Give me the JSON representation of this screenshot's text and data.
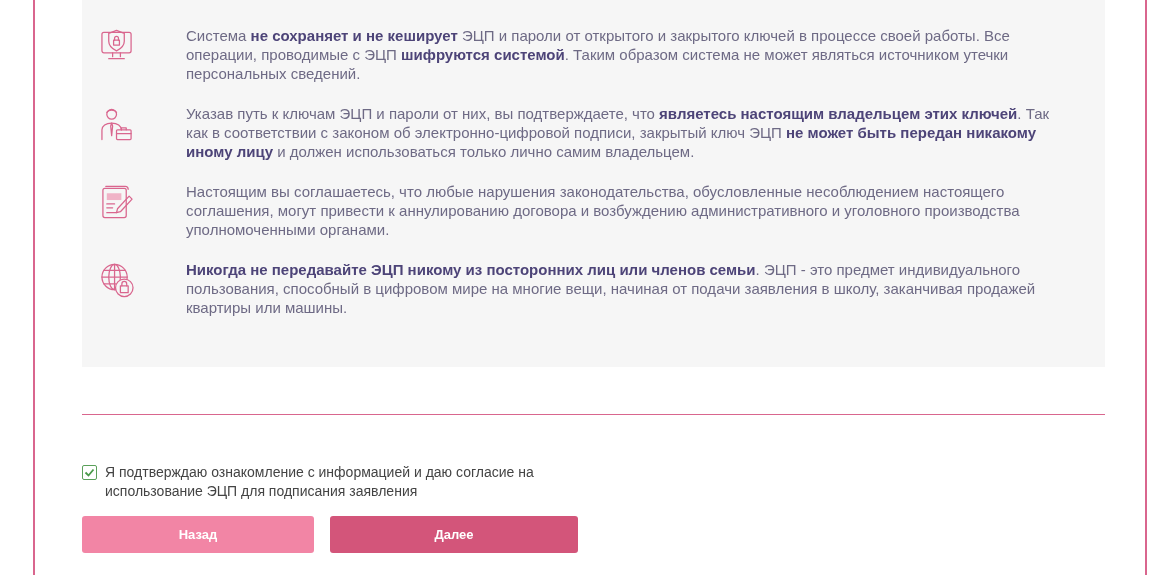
{
  "notices": [
    {
      "kind": "monitor",
      "text": "Система **не сохраняет и не кеширует** ЭЦП и пароли от открытого и закрытого ключей в процессе своей работы. Все операции, проводимые с ЭЦП **шифруются системой**. Таким образом система не может являться источником утечки персональных сведений."
    },
    {
      "kind": "person",
      "text": "Указав путь к ключам ЭЦП и пароли от них, вы подтверждаете, что **являетесь настоящим владельцем этих ключей**. Так как в соответствии с законом об электронно-цифровой подписи, закрытый ключ ЭЦП **не может быть передан никакому иному лицу** и должен использоваться только лично самим владельцем."
    },
    {
      "kind": "document",
      "text": "Настоящим вы соглашаетесь, что любые нарушения законодательства, обусловленные несоблюдением настоящего соглашения, могут привести к аннулированию договора и возбуждению административного и уголовного производства уполномоченными органами."
    },
    {
      "kind": "globe",
      "text": "**Никогда не передавайте ЭЦП никому из посторонних лиц или членов семьи**. ЭЦП - это предмет индивидуального пользования, способный в цифровом мире на многие вещи, начиная от подачи заявления в школу, заканчивая продажей квартиры или машины."
    }
  ],
  "consent": {
    "label": "Я подтверждаю ознакомление с информацией и даю согласие на использование ЭЦП для подписания заявления",
    "checked": true
  },
  "buttons": [
    {
      "kind": "back",
      "label": "Назад"
    },
    {
      "kind": "next",
      "label": "Далее"
    }
  ]
}
